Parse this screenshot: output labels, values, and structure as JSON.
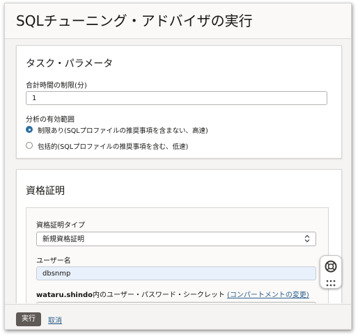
{
  "header": {
    "title": "SQLチューニング・アドバイザの実行"
  },
  "task_params": {
    "heading": "タスク・パラメータ",
    "total_time_label": "合計時間の制限(分)",
    "total_time_value": "1",
    "scope_label": "分析の有効範囲",
    "options": [
      {
        "label": "制限あり(SQLプロファイルの推奨事項を含まない、高速)",
        "checked": true
      },
      {
        "label": "包括的(SQLプロファイルの推奨事項を含む、低速)",
        "checked": false
      }
    ]
  },
  "credentials": {
    "heading": "資格証明",
    "type_label": "資格証明タイプ",
    "type_value": "新規資格証明",
    "username_label": "ユーザー名",
    "username_value": "dbsnmp",
    "secret_prefix": "wataru.shindo",
    "secret_text": "内のユーザー・パスワード・シークレット",
    "secret_link": "(コンパートメントの変更)"
  },
  "footer": {
    "run_label": "実行",
    "cancel_label": "取消"
  },
  "icons": {
    "help": "lifebuoy-icon",
    "menu": "grid-dots-icon"
  },
  "colors": {
    "accent": "#2c6fa3",
    "link": "#2b5d8c",
    "run_button": "#5f5a56",
    "autofill": "#e8f0fb"
  }
}
